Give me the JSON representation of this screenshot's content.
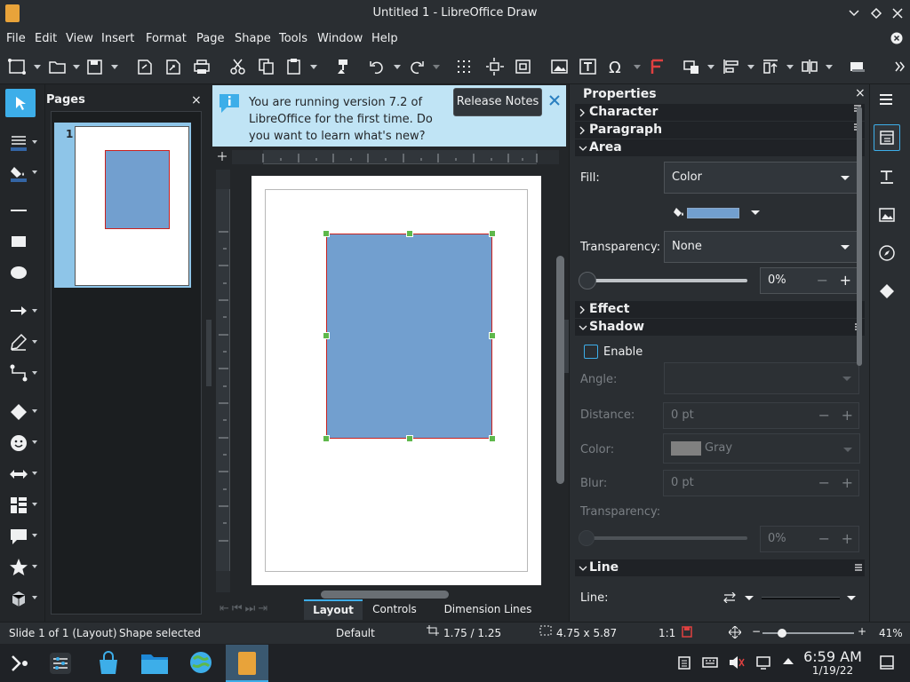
{
  "window": {
    "title": "Untitled 1 - LibreOffice Draw"
  },
  "menu": [
    "File",
    "Edit",
    "View",
    "Insert",
    "Format",
    "Page",
    "Shape",
    "Tools",
    "Window",
    "Help"
  ],
  "pages_panel": {
    "title": "Pages",
    "thumb_number": "1"
  },
  "infobar": {
    "message": "You are running version 7.2 of LibreOffice for the first time. Do you want to learn what's new?",
    "button": "Release Notes"
  },
  "tabs": [
    "Layout",
    "Controls",
    "Dimension Lines"
  ],
  "sidebar": {
    "title": "Properties",
    "sections": {
      "character": "Character",
      "paragraph": "Paragraph",
      "area": "Area",
      "effect": "Effect",
      "shadow": "Shadow",
      "line": "Line"
    },
    "area": {
      "fill_label": "Fill:",
      "fill_value": "Color",
      "transparency_label": "Transparency:",
      "transparency_value": "None",
      "transparency_percent": "0%",
      "fill_color": "#729fcf"
    },
    "shadow": {
      "enable": "Enable",
      "angle_label": "Angle:",
      "distance_label": "Distance:",
      "distance_value": "0 pt",
      "color_label": "Color:",
      "color_value": "Gray",
      "blur_label": "Blur:",
      "blur_value": "0 pt",
      "transparency_label": "Transparency:",
      "transparency_value": "0%"
    },
    "line": {
      "line_label": "Line:"
    }
  },
  "status": {
    "slide": "Slide 1 of 1 (Layout)",
    "selection": "Shape selected",
    "master": "Default",
    "position": "1.75 / 1.25",
    "size": "4.75 x 5.87",
    "scale": "1:1",
    "zoom": "41%"
  },
  "taskbar": {
    "time": "6:59 AM",
    "date": "1/19/22"
  },
  "colors": {
    "accent": "#3daee9",
    "shape_fill": "#729fcf",
    "shape_border": "#c9211e",
    "handle": "#5eb84b"
  }
}
